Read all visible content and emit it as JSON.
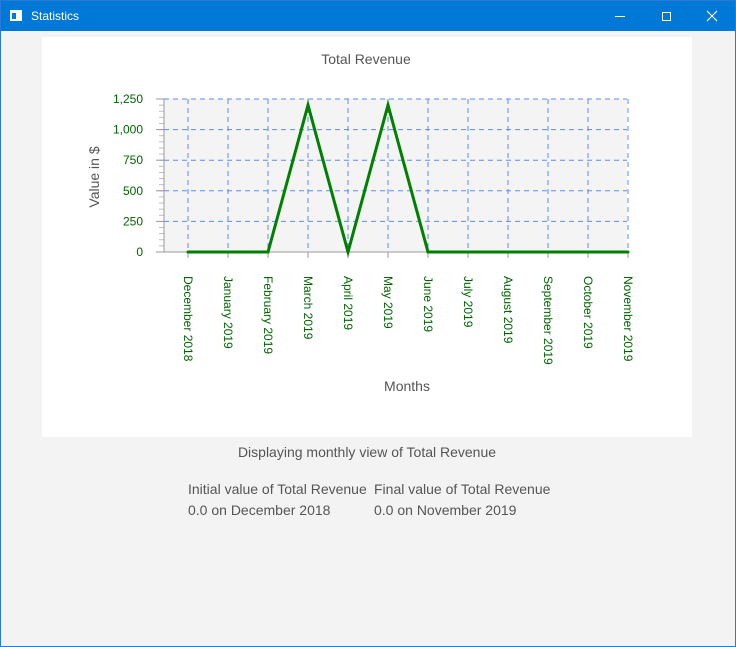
{
  "window": {
    "title": "Statistics",
    "icons": {
      "app": "app-window-icon",
      "minimize": "minimize-icon",
      "maximize": "maximize-icon",
      "close": "close-icon"
    }
  },
  "chart_data": {
    "type": "line",
    "title": "Total Revenue",
    "xlabel": "Months",
    "ylabel": "Value in $",
    "categories": [
      "December 2018",
      "January 2019",
      "February 2019",
      "March 2019",
      "April 2019",
      "May 2019",
      "June 2019",
      "July 2019",
      "August 2019",
      "September 2019",
      "October 2019",
      "November 2019"
    ],
    "series": [
      {
        "values": [
          0,
          0,
          0,
          1200,
          0,
          1200,
          0,
          0,
          0,
          0,
          0,
          0
        ],
        "color": "#008000"
      }
    ],
    "ylim": [
      0,
      1250
    ],
    "yticks": [
      0,
      250,
      500,
      750,
      1000,
      1250
    ],
    "ytick_labels": [
      "0",
      "250",
      "500",
      "750",
      "1,000",
      "1,250"
    ],
    "grid": true,
    "grid_color": "#5b8cf5",
    "plot_background": "#f4f4f4",
    "tick_label_color": "#006400"
  },
  "caption": "Displaying monthly view of Total Revenue",
  "summary": {
    "initial_label": "Initial value of Total Revenue",
    "initial_value": "0.0 on December 2018",
    "final_label": "Final value of Total Revenue",
    "final_value": "0.0 on November 2019"
  }
}
